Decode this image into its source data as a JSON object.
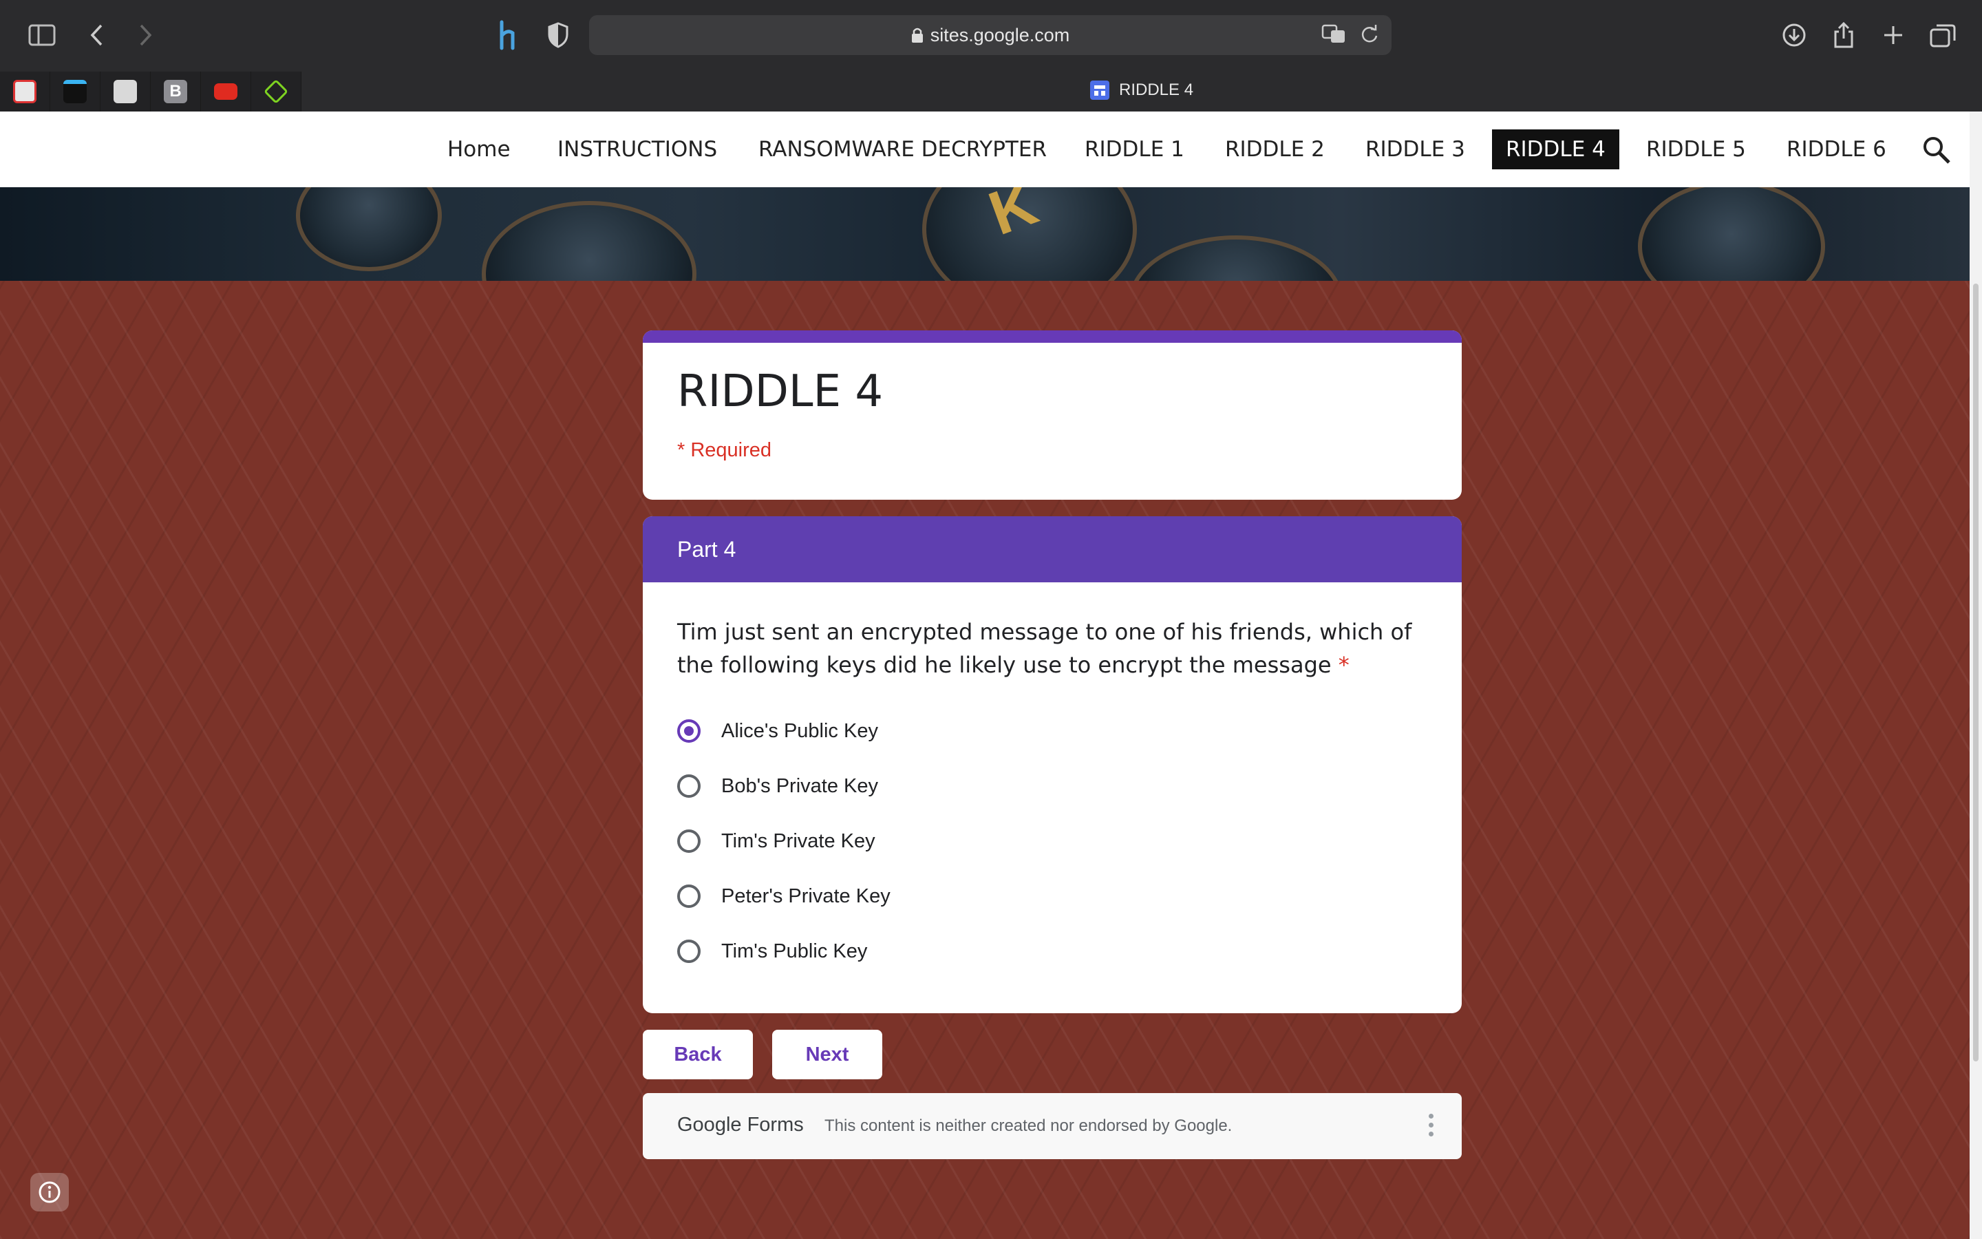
{
  "browser": {
    "url": "sites.google.com",
    "tab_title": "RIDDLE 4",
    "favicons": [
      "cloud-app-icon",
      "terminal-icon",
      "mascot-icon",
      "b-app-icon",
      "youtube-icon",
      "cube-icon"
    ],
    "favicon_colors": [
      "#e8e8e8",
      "#111111",
      "#d9d9d9",
      "#8e8e93",
      "#e02b20",
      "#3c3c3e"
    ]
  },
  "nav": {
    "items": [
      "Home",
      "INSTRUCTIONS",
      "RANSOMWARE DECRYPTER",
      "RIDDLE 1",
      "RIDDLE 2",
      "RIDDLE 3",
      "RIDDLE 4",
      "RIDDLE 5",
      "RIDDLE 6"
    ],
    "active": "RIDDLE 4"
  },
  "form": {
    "title": "RIDDLE 4",
    "required_note": "* Required",
    "section_title": "Part 4",
    "question": "Tim just sent an encrypted message to one of his friends, which of the following keys did he likely use to encrypt the message",
    "required_star": "*",
    "options": [
      "Alice's Public Key",
      "Bob's Private Key",
      "Tim's Private Key",
      "Peter's Private Key",
      "Tim's Public Key"
    ],
    "selected": "Alice's Public Key",
    "back_label": "Back",
    "next_label": "Next",
    "footer_brand": "Google Forms",
    "footer_disclaimer": "This content is neither created nor endorsed by Google."
  },
  "colors": {
    "accent": "#673ab7",
    "section_header": "#5f3fb0",
    "required": "#d93025",
    "background": "#7b3329"
  }
}
